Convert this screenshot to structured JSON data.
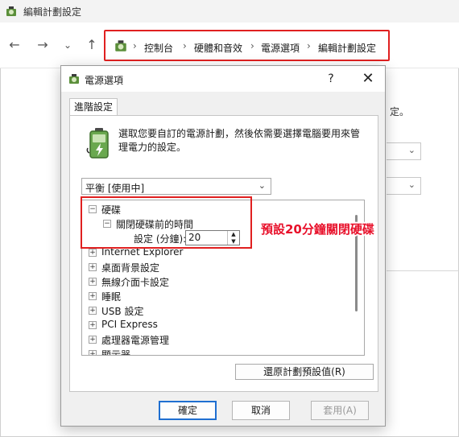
{
  "window": {
    "title": "編輯計劃設定"
  },
  "nav": {
    "back_icon": "arrow-left-icon",
    "forward_icon": "arrow-right-icon",
    "recent_icon": "chevron-down-icon",
    "up_icon": "arrow-up-icon",
    "breadcrumbs": [
      "控制台",
      "硬體和音效",
      "電源選項",
      "編輯計劃設定"
    ],
    "separator": "›",
    "highlight_color": "#e02020"
  },
  "background": {
    "partial_text": "定。"
  },
  "dialog": {
    "title": "電源選項",
    "help_label": "?",
    "close_label": "✕",
    "tab_label": "進階設定",
    "description": "選取您要自訂的電源計劃，然後依需要選擇電腦要用來管理電力的設定。",
    "plan_selected": "平衡 [使用中]",
    "tree": [
      {
        "id": "hdd",
        "label": "硬碟",
        "expander": "⊟",
        "level": 0
      },
      {
        "id": "hdd-off",
        "label": "關閉硬碟前的時間",
        "expander": "⊟",
        "level": 1
      },
      {
        "id": "setting",
        "label": "設定 (分鐘):",
        "level": 2,
        "value": "20"
      },
      {
        "id": "ie",
        "label": "Internet Explorer",
        "expander": "⊞",
        "level": 0
      },
      {
        "id": "desktop",
        "label": "桌面背景設定",
        "expander": "⊞",
        "level": 0
      },
      {
        "id": "wireless",
        "label": "無線介面卡設定",
        "expander": "⊞",
        "level": 0
      },
      {
        "id": "sleep",
        "label": "睡眠",
        "expander": "⊞",
        "level": 0
      },
      {
        "id": "usb",
        "label": "USB 設定",
        "expander": "⊞",
        "level": 0
      },
      {
        "id": "pcie",
        "label": "PCI Express",
        "expander": "⊞",
        "level": 0
      },
      {
        "id": "cpu",
        "label": "處理器電源管理",
        "expander": "⊞",
        "level": 0
      },
      {
        "id": "display",
        "label": "顯示器",
        "expander": "⊞",
        "level": 0
      }
    ],
    "restore_label": "還原計劃預設值(R)",
    "ok_label": "確定",
    "cancel_label": "取消",
    "apply_label": "套用(A)"
  },
  "annotation": {
    "text": "預設20分鐘關閉硬碟",
    "color": "#e8102a"
  }
}
